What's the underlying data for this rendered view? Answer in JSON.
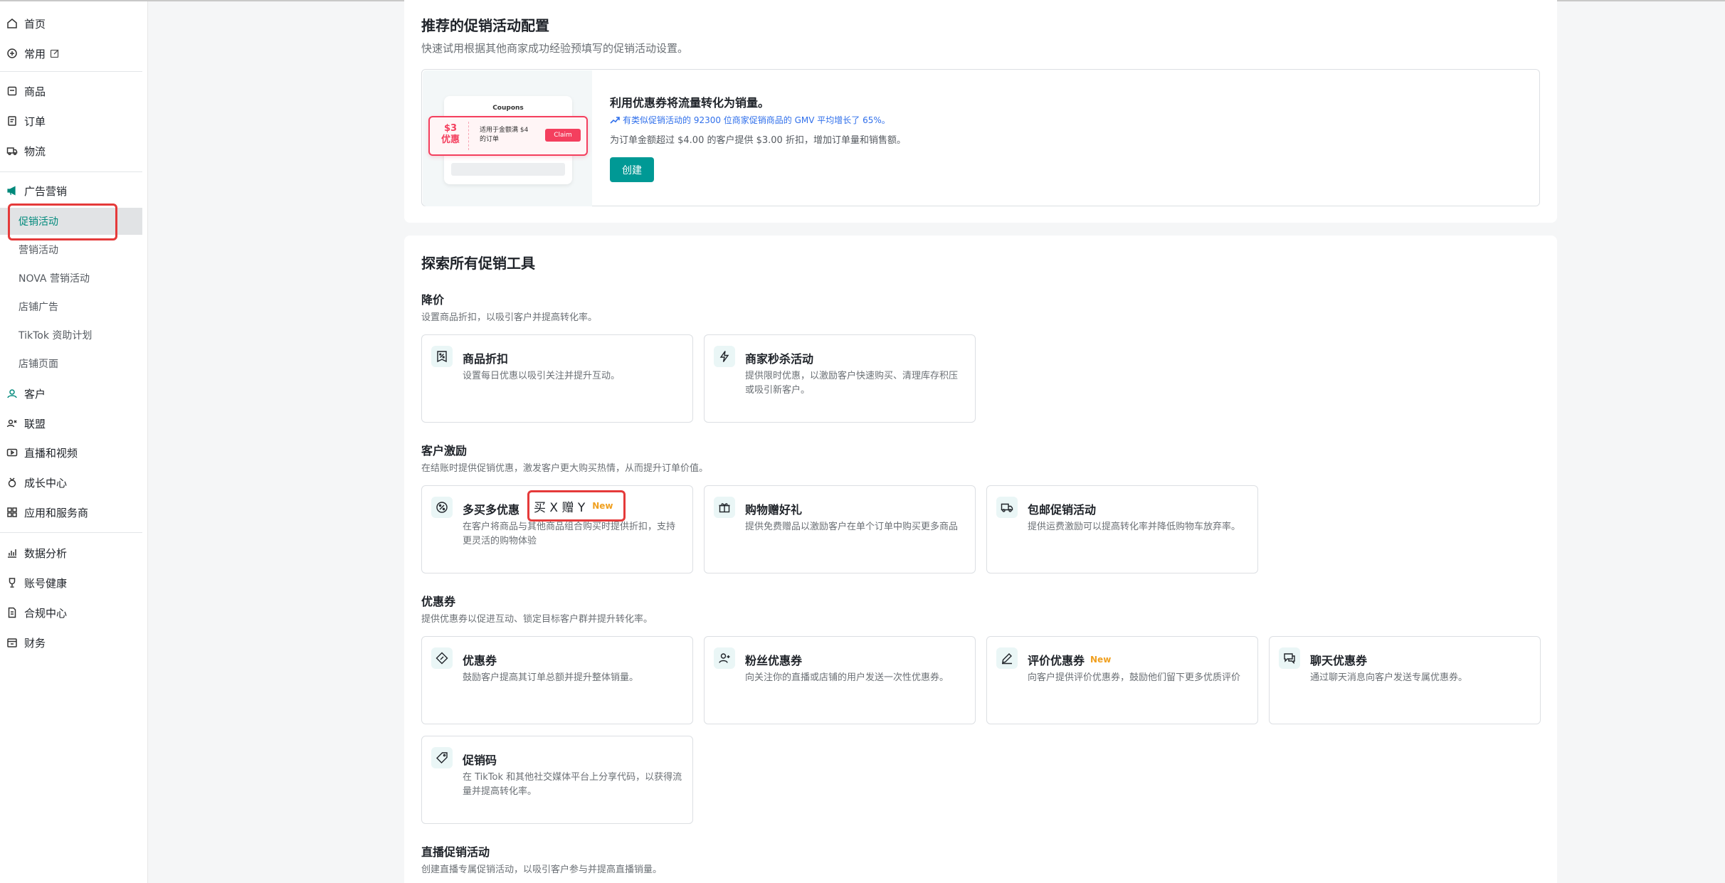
{
  "sidebar": {
    "home": "首页",
    "common": "常用",
    "products": "商品",
    "orders": "订单",
    "logistics": "物流",
    "ads_marketing": "广告营销",
    "sub_items": [
      "促销活动",
      "营销活动",
      "NOVA 营销活动",
      "店铺广告",
      "TikTok 资助计划",
      "店铺页面"
    ],
    "customers": "客户",
    "affiliate": "联盟",
    "live_video": "直播和视频",
    "growth": "成长中心",
    "apps": "应用和服务商",
    "analytics": "数据分析",
    "account_health": "账号健康",
    "compliance": "合规中心",
    "finance": "财务"
  },
  "recommended": {
    "title": "推荐的促销活动配置",
    "subtitle": "快速试用根据其他商家成功经验预填写的促销活动设置。",
    "card": {
      "image": {
        "coupon_title": "Coupons",
        "amount": "$3",
        "amount_label": "优惠",
        "condition": "适用于金额满 $4 的订单",
        "claim": "Claim"
      },
      "title": "利用优惠券将流量转化为销量。",
      "stat": "有类似促销活动的 92300 位商家促销商品的 GMV 平均增长了 65%。",
      "desc": "为订单金额超过 $4.00 的客户提供 $3.00 折扣，增加订单量和销售额。",
      "create": "创建"
    }
  },
  "explore": {
    "title": "探索所有促销工具",
    "new_badge": "New",
    "sections": {
      "price_drop": {
        "title": "降价",
        "subtitle": "设置商品折扣，以吸引客户并提高转化率。",
        "tools": [
          {
            "name": "商品折扣",
            "desc": "设置每日优惠以吸引关注并提升互动。"
          },
          {
            "name": "商家秒杀活动",
            "desc": "提供限时优惠，以激励客户快速购买、清理库存积压或吸引新客户。"
          }
        ]
      },
      "incentives": {
        "title": "客户激励",
        "subtitle": "在结账时提供促销优惠，激发客户更大购买热情，从而提升订单价值。",
        "tools": [
          {
            "name": "多买多优惠",
            "desc": "在客户将商品与其他商品组合购买时提供折扣，支持更灵活的购物体验"
          },
          {
            "name": "购物赠好礼",
            "desc": "提供免费赠品以激励客户在单个订单中购买更多商品"
          },
          {
            "name": "包邮促销活动",
            "desc": "提供运费激励可以提高转化率并降低购物车放弃率。"
          }
        ],
        "highlight": "买 X 赠 Y"
      },
      "coupons": {
        "title": "优惠券",
        "subtitle": "提供优惠券以促进互动、锁定目标客户群并提升转化率。",
        "tools": [
          {
            "name": "优惠券",
            "desc": "鼓励客户提高其订单总额并提升整体销量。"
          },
          {
            "name": "粉丝优惠券",
            "desc": "向关注你的直播或店铺的用户发送一次性优惠券。"
          },
          {
            "name": "评价优惠券",
            "desc": "向客户提供评价优惠券，鼓励他们留下更多优质评价"
          },
          {
            "name": "聊天优惠券",
            "desc": "通过聊天消息向客户发送专属优惠券。"
          },
          {
            "name": "促销码",
            "desc": "在 TikTok 和其他社交媒体平台上分享代码，以获得流量并提高转化率。"
          }
        ]
      },
      "live": {
        "title": "直播促销活动",
        "subtitle": "创建直播专属促销活动，以吸引客户参与并提高直播销量。"
      }
    }
  }
}
